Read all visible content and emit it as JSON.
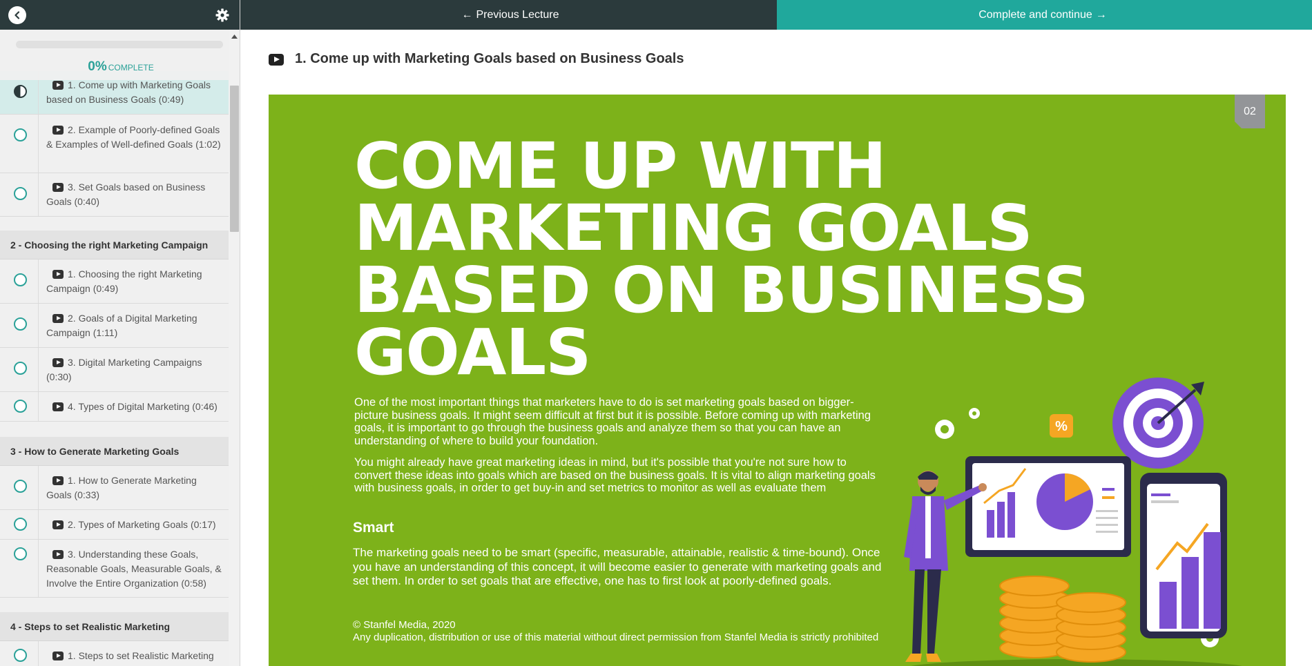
{
  "topbar": {
    "prev_label": "Previous Lecture",
    "next_label": "Complete and continue"
  },
  "sidebar": {
    "progress_percent": "0%",
    "progress_label": "COMPLETE",
    "items": [
      {
        "type": "lecture",
        "text": "1. Come up with Marketing Goals based on Business Goals (0:49)",
        "status": "active"
      },
      {
        "type": "lecture",
        "text": "2. Example of Poorly-defined Goals & Examples of Well-defined Goals (1:02)"
      },
      {
        "type": "lecture",
        "text": "3. Set Goals based on Business Goals (0:40)"
      },
      {
        "type": "section",
        "text": "2 - Choosing the right Marketing Campaign"
      },
      {
        "type": "lecture",
        "text": "1. Choosing the right Marketing Campaign (0:49)"
      },
      {
        "type": "lecture",
        "text": "2. Goals of a Digital Marketing Campaign (1:11)"
      },
      {
        "type": "lecture",
        "text": "3. Digital Marketing Campaigns (0:30)"
      },
      {
        "type": "lecture",
        "text": "4. Types of Digital Marketing (0:46)"
      },
      {
        "type": "section",
        "text": "3 - How to Generate Marketing Goals"
      },
      {
        "type": "lecture",
        "text": "1. How to Generate Marketing Goals (0:33)"
      },
      {
        "type": "lecture",
        "text": "2. Types of Marketing Goals (0:17)"
      },
      {
        "type": "lecture",
        "text": "3. Understanding these Goals, Reasonable Goals, Measurable Goals, & Involve the Entire Organization (0:58)"
      },
      {
        "type": "section",
        "text": "4 - Steps to set Realistic Marketing"
      },
      {
        "type": "lecture",
        "text": "1. Steps to set Realistic Marketing"
      }
    ]
  },
  "lecture": {
    "title": "1. Come up with Marketing Goals based on Business Goals"
  },
  "slide": {
    "number": "02",
    "heading": "COME UP WITH MARKETING GOALS BASED ON BUSINESS GOALS",
    "paragraph1": "One of the most important things that marketers have to do is set marketing goals based on bigger-picture business goals. It might seem difficult at first but it is possible. Before coming up with marketing goals, it is important to go through the business goals and analyze them so that you can have an understanding of where to build your foundation.",
    "paragraph2": "You might already have great marketing ideas in mind, but it's possible that you're not sure how to convert these ideas into goals which are based on the business goals. It is vital to align marketing goals with business goals, in order to get buy-in and set metrics to monitor as well as evaluate them",
    "subheading": "Smart",
    "paragraph3": "The marketing goals need to be smart (specific, measurable, attainable, realistic & time-bound). Once you have an understanding of this concept, it will become easier to generate with marketing goals and set them. In order to set goals that are effective, one has to first look at poorly-defined goals.",
    "copyright": "© Stanfel Media, 2020",
    "disclaimer": "Any duplication, distribution or use of this material without direct permission from Stanfel Media is strictly prohibited",
    "badge_symbol": "%"
  },
  "colors": {
    "accent": "#20a89c",
    "topbar_dark": "#2b3a3c",
    "slide_green": "#7db21a",
    "illustration_purple": "#7b4fd1",
    "coin_orange": "#f5a623"
  }
}
